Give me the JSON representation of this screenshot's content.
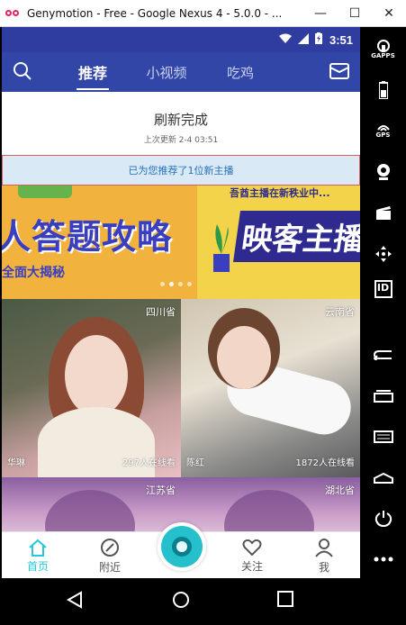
{
  "window": {
    "title": "Genymotion - Free - Google Nexus 4 - 5.0.0 - ...",
    "minimize": "—",
    "maximize": "☐",
    "close": "✕"
  },
  "statusbar": {
    "time": "3:51"
  },
  "tabs": [
    {
      "label": "推荐",
      "active": true
    },
    {
      "label": "小视频",
      "active": false
    },
    {
      "label": "吃鸡",
      "active": false
    }
  ],
  "refresh": {
    "title": "刷新完成",
    "last_update": "上次更新 2-4 03:51"
  },
  "notice": "已为您推荐了1位新主播",
  "banners": [
    {
      "headline": "人答题攻略",
      "subline": "全面大揭秘"
    },
    {
      "topline": "吾酋主播在新秩业中...",
      "headline": "映客主播"
    }
  ],
  "cards": [
    {
      "location": "四川省",
      "name": "华琳",
      "viewers": "297人在线看"
    },
    {
      "location": "云南省",
      "name": "陈红",
      "viewers": "1872人在线看"
    },
    {
      "location": "江苏省",
      "name": "",
      "viewers": ""
    },
    {
      "location": "湖北省",
      "name": "",
      "viewers": ""
    }
  ],
  "bottomnav": [
    {
      "label": "首页",
      "icon": "home-icon",
      "active": true
    },
    {
      "label": "附近",
      "icon": "compass-icon",
      "active": false
    },
    {
      "label": "关注",
      "icon": "heart-icon",
      "active": false
    },
    {
      "label": "我",
      "icon": "person-icon",
      "active": false
    }
  ],
  "side_buttons": [
    {
      "label": "GAPPS",
      "icon": "gapps-icon"
    },
    {
      "label": "",
      "icon": "battery-icon"
    },
    {
      "label": "GPS",
      "icon": "gps-icon"
    },
    {
      "label": "",
      "icon": "webcam-icon"
    },
    {
      "label": "",
      "icon": "clapperboard-icon"
    },
    {
      "label": "",
      "icon": "move-icon"
    },
    {
      "label": "ID",
      "icon": "id-icon"
    },
    {
      "label": "",
      "icon": "back-icon"
    },
    {
      "label": "",
      "icon": "recent-apps-icon"
    },
    {
      "label": "",
      "icon": "menu-icon"
    },
    {
      "label": "",
      "icon": "home-icon"
    },
    {
      "label": "",
      "icon": "power-icon"
    },
    {
      "label": "",
      "icon": "more-icon"
    }
  ],
  "colors": {
    "appbar": "#3246a8",
    "statusbar": "#2f3da0",
    "accent": "#25c7d8",
    "notice_bg": "#d9eaf6",
    "notice_text": "#2870b8"
  }
}
